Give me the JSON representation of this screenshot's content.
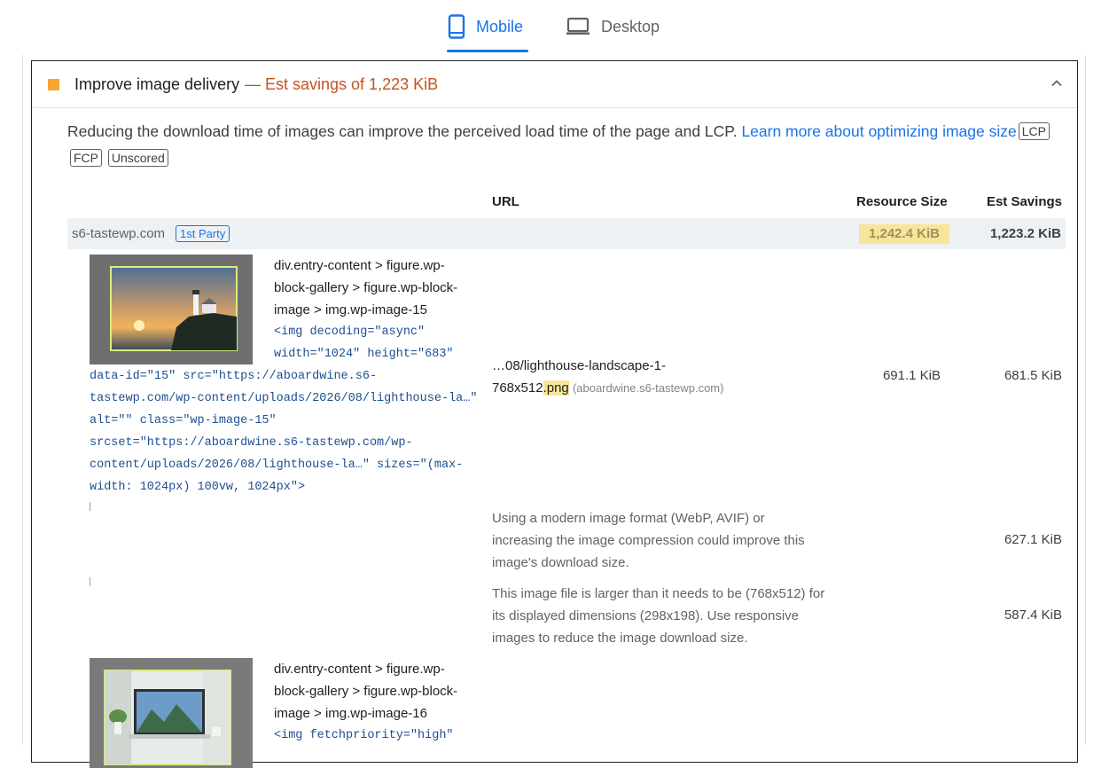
{
  "tabs": [
    {
      "label": "Mobile",
      "icon": "mobile-phone-icon",
      "active": true
    },
    {
      "label": "Desktop",
      "icon": "laptop-icon",
      "active": false
    }
  ],
  "audit": {
    "title": "Improve image delivery",
    "savings_text": "— Est savings of 1,223 KiB",
    "severity_color": "#f8a530",
    "description": "Reducing the download time of images can improve the perceived load time of the page and LCP.",
    "learn_more": "Learn more about optimizing image size",
    "tags": [
      "LCP",
      "FCP",
      "Unscored"
    ]
  },
  "table": {
    "headers": {
      "url": "URL",
      "resource_size": "Resource Size",
      "est_savings": "Est Savings"
    },
    "group": {
      "entity": "s6-tastewp.com",
      "badge": "1st Party",
      "resource_size": "1,242.4 KiB",
      "est_savings": "1,223.2 KiB"
    },
    "items": [
      {
        "node_path": "div.entry-content > figure.wp-block-gallery > figure.wp-block-image > img.wp-image-15",
        "snippet_lines": [
          "<img decoding=\"async\"",
          "width=\"1024\" height=\"683\"",
          "data-id=\"15\" src=\"https://aboardwine.s6-",
          "tastewp.com/wp-content/uploads/2026/08/lighthouse-la…\"",
          "alt=\"\" class=\"wp-image-15\"",
          "srcset=\"https://aboardwine.s6-tastewp.com/wp-",
          "content/uploads/2026/08/lighthouse-la…\" sizes=\"(max-",
          "width: 1024px) 100vw, 1024px\">"
        ],
        "url_prefix": "…08/lighthouse-landscape-1-",
        "url_file": "768x512",
        "url_ext": ".png",
        "url_origin": "(aboardwine.s6-tastewp.com)",
        "resource_size": "691.1 KiB",
        "est_savings": "681.5 KiB",
        "subitems": [
          {
            "text": "Using a modern image format (WebP, AVIF) or increasing the image compression could improve this image's download size.",
            "savings": "627.1 KiB"
          },
          {
            "text": "This image file is larger than it needs to be (768x512) for its displayed dimensions (298x198). Use responsive images to reduce the image download size.",
            "savings": "587.4 KiB"
          }
        ]
      },
      {
        "node_path": "div.entry-content > figure.wp-block-gallery > figure.wp-block-image > img.wp-image-16",
        "snippet_lines": [
          "<img fetchpriority=\"high\""
        ]
      }
    ]
  }
}
